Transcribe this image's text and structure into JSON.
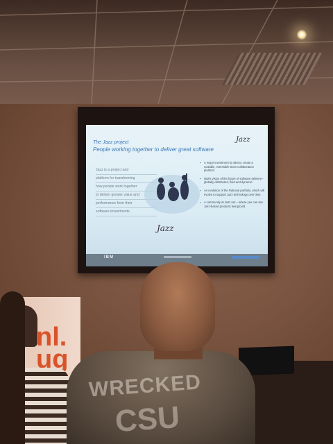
{
  "slide": {
    "title": "The Jazz project",
    "subtitle": "People working together to deliver great software",
    "jazz_top": "Jazz",
    "left_lines": [
      "Jazz is a project and",
      "platform for transforming",
      "how people work together",
      "to deliver greater value and",
      "performance from their",
      "software investments"
    ],
    "bullets": [
      "A major investment by IBM to create a scalable, extensible team collaboration platform.",
      "IBM's vision of the future of software delivery–globally distributed, fluid and dynamic.",
      "An evolution of the Rational portfolio, which will evolve to support Jazz technology over time.",
      "A community at Jazz.net – where you can see Jazz-based products being built."
    ],
    "jazz_logo": "Jazz",
    "footer_brand": "IBM"
  },
  "banner": {
    "text": "nl. ug"
  },
  "shirt": {
    "line1": "WRECKED",
    "line2": "CSU"
  }
}
